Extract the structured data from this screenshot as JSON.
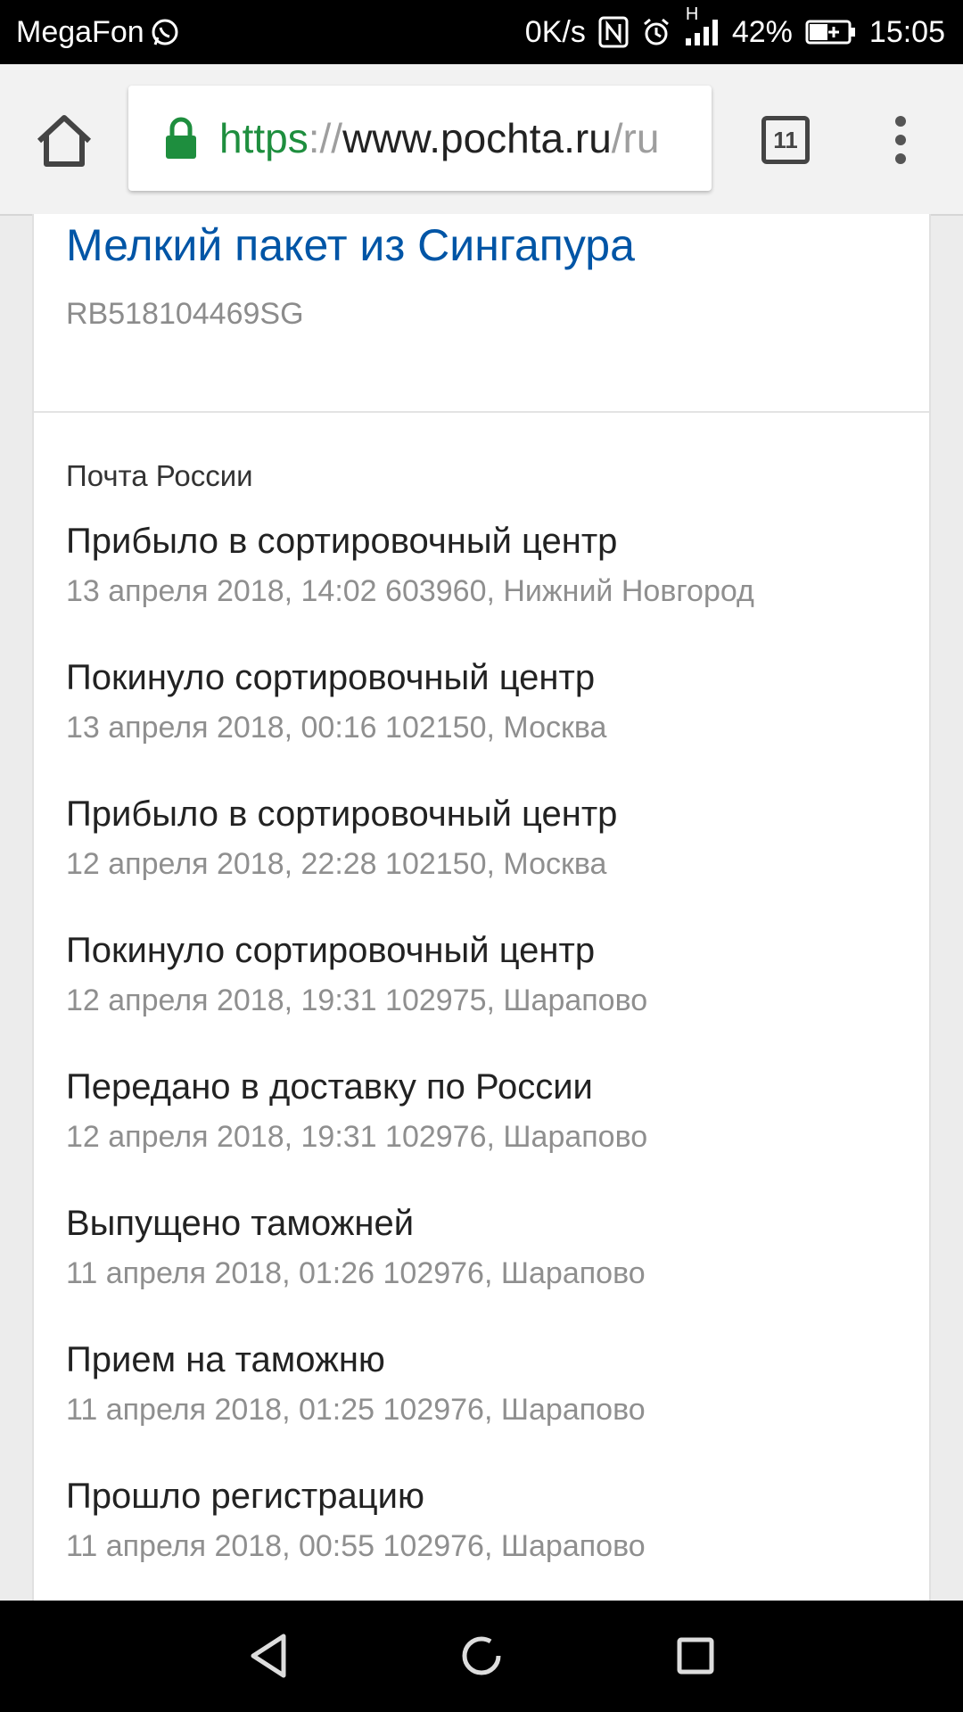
{
  "status_bar": {
    "carrier": "MegaFon",
    "speed": "0K/s",
    "network_type": "H",
    "battery": "42%",
    "time": "15:05",
    "icons": [
      "whatsapp-icon",
      "nfc-icon",
      "alarm-icon",
      "signal-icon",
      "battery-charging-icon"
    ]
  },
  "browser": {
    "url_scheme": "https",
    "url_sep": "://",
    "url_host": "www.pochta.ru",
    "url_path": "/ru",
    "tab_count": "11",
    "icons": [
      "home-icon",
      "lock-icon",
      "tabs-icon",
      "more-vert-icon"
    ]
  },
  "package": {
    "title": "Мелкий пакет из Сингапура",
    "tracking_number": "RB518104469SG"
  },
  "tracking": {
    "carrier": "Почта России",
    "events": [
      {
        "status": "Прибыло в сортировочный центр",
        "detail": "13 апреля 2018, 14:02 603960, Нижний Новгород"
      },
      {
        "status": "Покинуло сортировочный центр",
        "detail": "13 апреля 2018, 00:16 102150, Москва"
      },
      {
        "status": "Прибыло в сортировочный центр",
        "detail": "12 апреля 2018, 22:28 102150, Москва"
      },
      {
        "status": "Покинуло сортировочный центр",
        "detail": "12 апреля 2018, 19:31 102975, Шарапово"
      },
      {
        "status": "Передано в доставку по России",
        "detail": "12 апреля 2018, 19:31 102976, Шарапово"
      },
      {
        "status": "Выпущено таможней",
        "detail": "11 апреля 2018, 01:26 102976, Шарапово"
      },
      {
        "status": "Прием на таможню",
        "detail": "11 апреля 2018, 01:25 102976, Шарапово"
      },
      {
        "status": "Прошло регистрацию",
        "detail": "11 апреля 2018, 00:55 102976, Шарапово"
      }
    ]
  },
  "navigation": {
    "icons": [
      "back-icon",
      "home-circle-icon",
      "recents-icon"
    ]
  },
  "colors": {
    "title_link": "#0055a6",
    "secure_green": "#1e8e3e",
    "muted_text": "#8f8f8f"
  }
}
